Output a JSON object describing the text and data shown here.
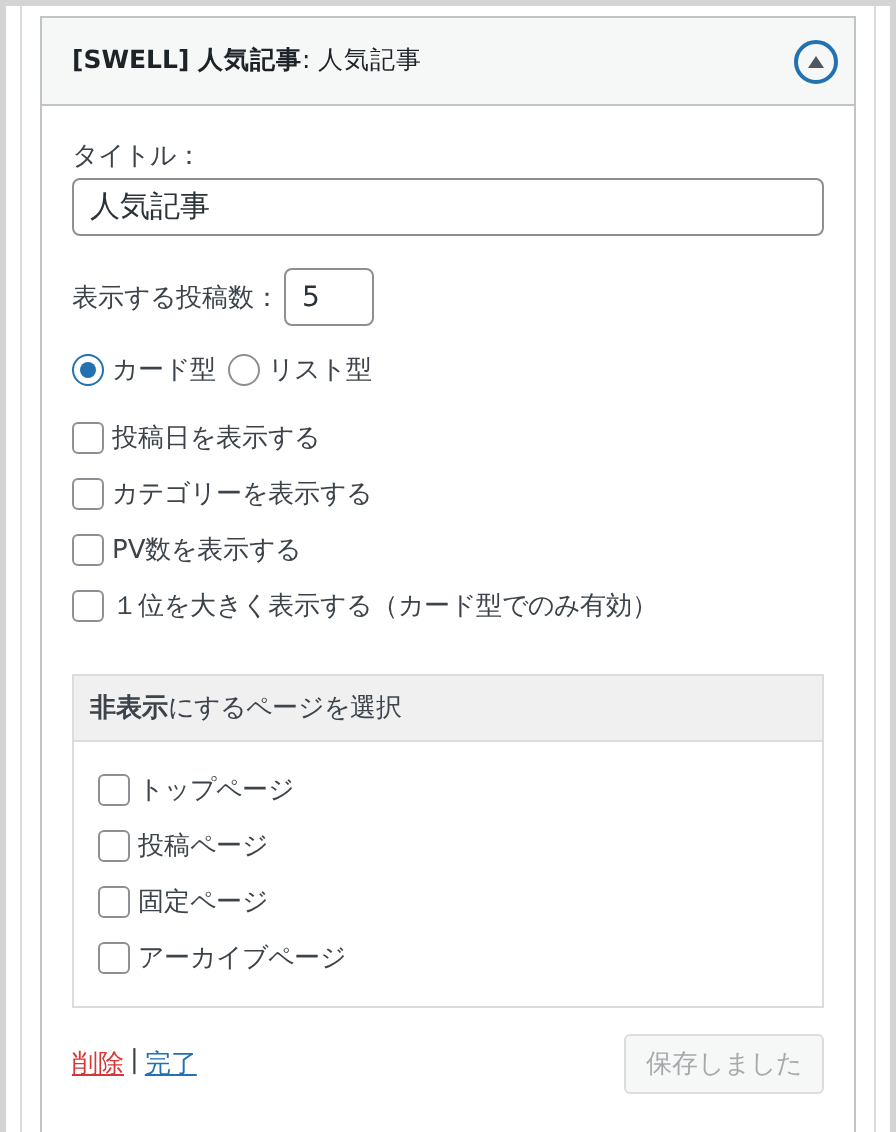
{
  "widget": {
    "title": "**[SWELL] 人気記事**: 人気記事",
    "expanded": true
  },
  "title_field": {
    "label": "タイトル：",
    "value": "人気記事"
  },
  "count_field": {
    "label": "表示する投稿数：",
    "value": "5"
  },
  "layout_options": [
    {
      "label": "カード型",
      "selected": true
    },
    {
      "label": "リスト型",
      "selected": false
    }
  ],
  "options": [
    {
      "label": "投稿日を表示する",
      "checked": false
    },
    {
      "label": "カテゴリーを表示する",
      "checked": false
    },
    {
      "label": "PV数を表示する",
      "checked": false
    },
    {
      "label": "１位を大きく表示する（カード型でのみ有効）",
      "checked": false
    }
  ],
  "hide_pages": {
    "title": "**非表示**にするページを選択",
    "items": [
      {
        "label": "トップページ",
        "checked": false
      },
      {
        "label": "投稿ページ",
        "checked": false
      },
      {
        "label": "固定ページ",
        "checked": false
      },
      {
        "label": "アーカイブページ",
        "checked": false
      }
    ]
  },
  "footer": {
    "delete_link": "削除",
    "separator": "|",
    "done_link": "完了",
    "save_button": {
      "label": "保存しました",
      "disabled": true
    }
  }
}
